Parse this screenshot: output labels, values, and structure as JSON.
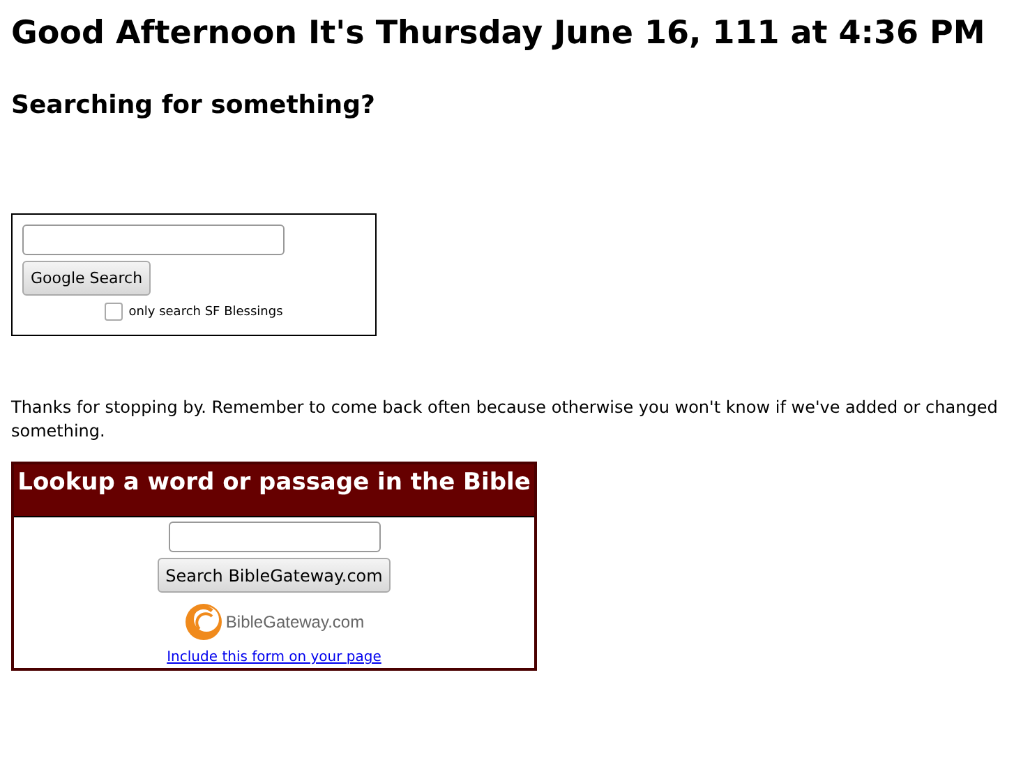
{
  "heading": "Good Afternoon It's Thursday June 16, 111 at 4:36 PM",
  "subheading": "Searching for something?",
  "google_search": {
    "button": "Google Search",
    "checkbox": {
      "label": "only search SF Blessings",
      "checked": false
    }
  },
  "message": "Thanks for stopping by. Remember to come back often because otherwise you won't know if we've added or changed something.",
  "bible_lookup": {
    "title": "Lookup a word or passage in the Bible",
    "button": "Search BibleGateway.com",
    "logo_text": "BibleGateway.com",
    "link": "Include this form on your page"
  }
}
